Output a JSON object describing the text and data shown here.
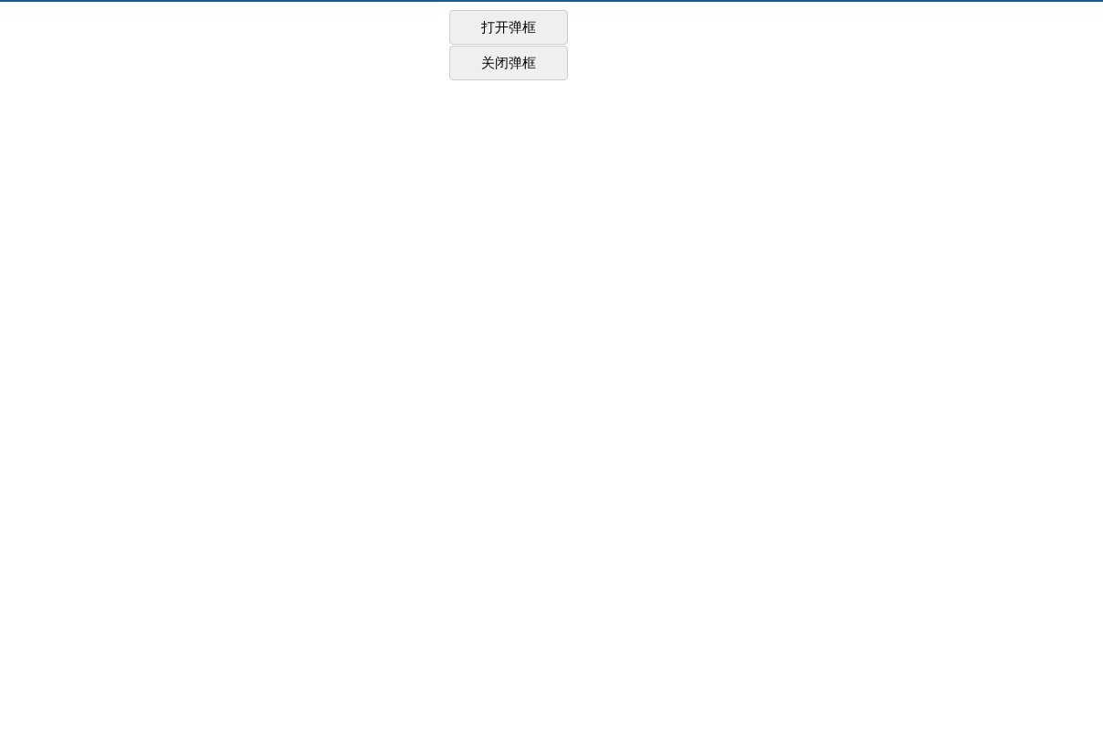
{
  "buttons": [
    {
      "label": "打开弹框"
    },
    {
      "label": "关闭弹框"
    }
  ]
}
